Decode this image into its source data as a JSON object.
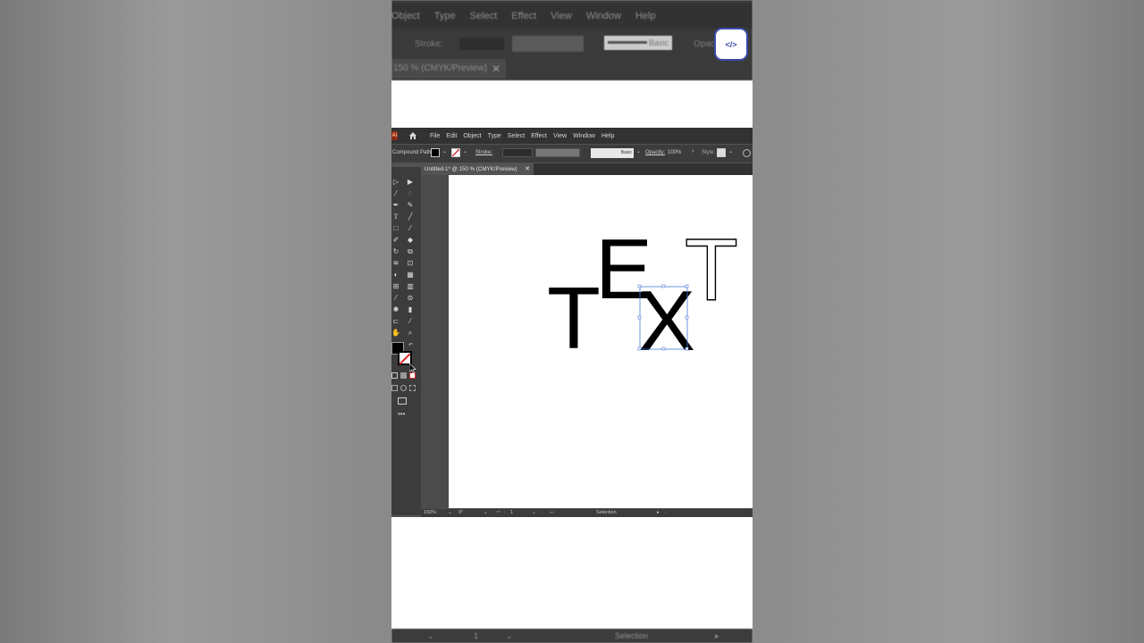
{
  "blurred_header": {
    "menu": [
      "Object",
      "Type",
      "Select",
      "Effect",
      "View",
      "Window",
      "Help"
    ],
    "stroke_label": "Stroke:",
    "brush_label": "Basic",
    "opacity_label": "Opaci",
    "tab_label": "150 % (CMYK/Preview)",
    "close": "✕"
  },
  "logo": {
    "text": "</>"
  },
  "menubar": {
    "app_badge": "Ai",
    "items": [
      "File",
      "Edit",
      "Object",
      "Type",
      "Select",
      "Effect",
      "View",
      "Window",
      "Help"
    ]
  },
  "control_bar": {
    "selection_type": "Compound Path",
    "stroke_label": "Stroke:",
    "brush_label": "Basic",
    "opacity_label": "Opacity:",
    "opacity_value": "100%",
    "style_label": "Style:"
  },
  "document_tab": {
    "title": "Untitled-1* @ 150 % (CMYK/Preview)",
    "close": "✕"
  },
  "canvas": {
    "letters": [
      {
        "char": "T",
        "style": "filled"
      },
      {
        "char": "E",
        "style": "filled"
      },
      {
        "char": "X",
        "style": "selected"
      },
      {
        "char": "T",
        "style": "outline"
      }
    ]
  },
  "status_bar": {
    "zoom": "150%",
    "rotation": "0°",
    "artboard": "1",
    "tool": "Selection"
  },
  "blurred_footer": {
    "artboard": "1",
    "tool": "Selection"
  },
  "colors": {
    "menubar": "#323232",
    "panel": "#3c3c3c",
    "workspace": "#535353",
    "selection": "#4a7bd6"
  }
}
